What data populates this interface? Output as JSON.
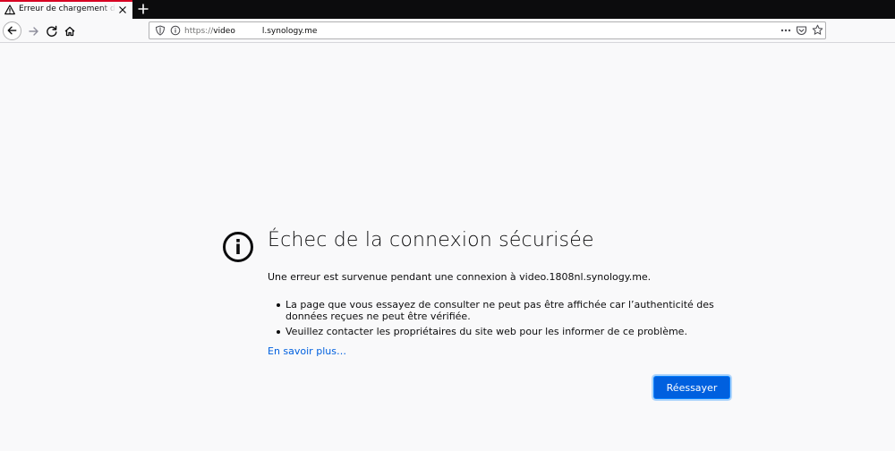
{
  "tab": {
    "title": "Erreur de chargement de la page",
    "icon": "warning-icon",
    "accent": "#d70022"
  },
  "toolbar": {
    "url_scheme": "https://",
    "url_host_start": "video",
    "url_host_end": "l.synology.me"
  },
  "error": {
    "title": "Échec de la connexion sécurisée",
    "description": "Une erreur est survenue pendant une connexion à video.1808nl.synology.me.",
    "bullets": [
      "La page que vous essayez de consulter ne peut pas être affichée car l’authenticité des données reçues ne peut être vérifiée.",
      "Veuillez contacter les propriétaires du site web pour les informer de ce problème."
    ],
    "learn_more": "En savoir plus…",
    "retry_label": "Réessayer",
    "button_color": "#0060df",
    "link_color": "#0060df"
  }
}
